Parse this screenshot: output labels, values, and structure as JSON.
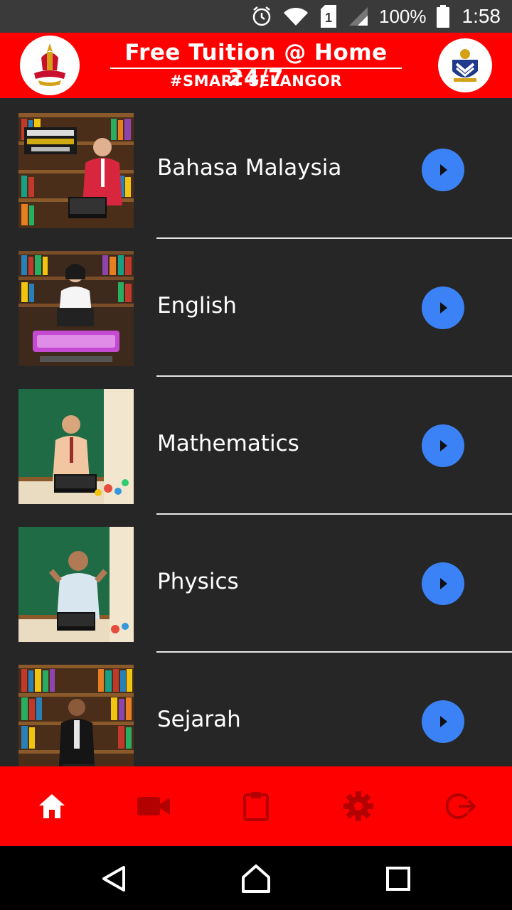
{
  "status_bar": {
    "battery": "100%",
    "time": "1:58",
    "sim_badge": "1",
    "icons": [
      "alarm-icon",
      "wifi-icon",
      "sim-icon",
      "signal-icon",
      "battery-icon"
    ]
  },
  "header": {
    "title": "Free Tuition @ Home 24/7",
    "subtitle": "#SMART SELANGOR",
    "left_logo": "selangor-crest-logo",
    "right_logo": "education-logo",
    "background": "#ff0000"
  },
  "subjects": [
    {
      "label": "Bahasa Malaysia",
      "thumb_icon": "video-thumbnail-library-teacher"
    },
    {
      "label": "English",
      "thumb_icon": "video-thumbnail-library-presenter"
    },
    {
      "label": "Mathematics",
      "thumb_icon": "video-thumbnail-chalkboard-teacher"
    },
    {
      "label": "Physics",
      "thumb_icon": "video-thumbnail-chalkboard-teacher"
    },
    {
      "label": "Sejarah",
      "thumb_icon": "video-thumbnail-library-teacher"
    }
  ],
  "play_button_color": "#3b82f6",
  "bottom_nav": {
    "items": [
      "home-icon",
      "video-camera-icon",
      "clipboard-icon",
      "gear-icon",
      "logout-icon"
    ],
    "active": "home-icon",
    "active_color": "#ffffff",
    "inactive_color": "#b30000"
  },
  "system_nav": [
    "back-icon",
    "home-circle-icon",
    "recents-icon"
  ]
}
